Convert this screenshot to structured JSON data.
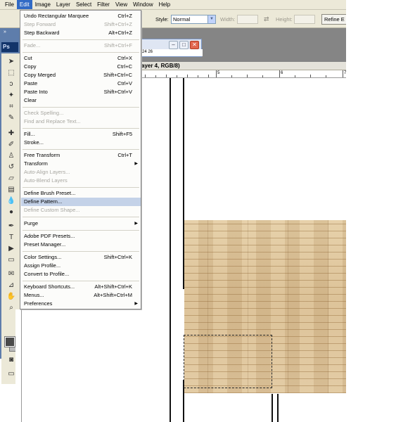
{
  "menubar": {
    "items": [
      "File",
      "Edit",
      "Image",
      "Layer",
      "Select",
      "Filter",
      "View",
      "Window",
      "Help"
    ],
    "active": "Edit"
  },
  "options_bar": {
    "style_label": "Style:",
    "style_value": "Normal",
    "width_label": "Width:",
    "height_label": "Height:",
    "refine_label": "Refine E"
  },
  "toolbox": {
    "logo_text": "Ps",
    "grip": "»"
  },
  "document": {
    "title_text": "ayer 4, RGB/8)",
    "small_ruler_text": "24      26",
    "ruler_numbers": [
      "5",
      "6",
      "7"
    ]
  },
  "edit_menu": {
    "group1": [
      {
        "label": "Undo Rectangular Marquee",
        "shortcut": "Ctrl+Z",
        "enabled": true
      },
      {
        "label": "Step Forward",
        "shortcut": "Shift+Ctrl+Z",
        "enabled": false
      },
      {
        "label": "Step Backward",
        "shortcut": "Alt+Ctrl+Z",
        "enabled": true
      }
    ],
    "group2": [
      {
        "label": "Fade...",
        "shortcut": "Shift+Ctrl+F",
        "enabled": false
      }
    ],
    "group3": [
      {
        "label": "Cut",
        "shortcut": "Ctrl+X",
        "enabled": true
      },
      {
        "label": "Copy",
        "shortcut": "Ctrl+C",
        "enabled": true
      },
      {
        "label": "Copy Merged",
        "shortcut": "Shift+Ctrl+C",
        "enabled": true
      },
      {
        "label": "Paste",
        "shortcut": "Ctrl+V",
        "enabled": true
      },
      {
        "label": "Paste Into",
        "shortcut": "Shift+Ctrl+V",
        "enabled": true
      },
      {
        "label": "Clear",
        "shortcut": "",
        "enabled": true
      }
    ],
    "group4": [
      {
        "label": "Check Spelling...",
        "shortcut": "",
        "enabled": false
      },
      {
        "label": "Find and Replace Text...",
        "shortcut": "",
        "enabled": false
      }
    ],
    "group5": [
      {
        "label": "Fill...",
        "shortcut": "Shift+F5",
        "enabled": true
      },
      {
        "label": "Stroke...",
        "shortcut": "",
        "enabled": true
      }
    ],
    "group6": [
      {
        "label": "Free Transform",
        "shortcut": "Ctrl+T",
        "enabled": true
      },
      {
        "label": "Transform",
        "shortcut": "",
        "enabled": true,
        "submenu": true
      },
      {
        "label": "Auto-Align Layers...",
        "shortcut": "",
        "enabled": false
      },
      {
        "label": "Auto-Blend Layers",
        "shortcut": "",
        "enabled": false
      }
    ],
    "group7": [
      {
        "label": "Define Brush Preset...",
        "shortcut": "",
        "enabled": true
      },
      {
        "label": "Define Pattern...",
        "shortcut": "",
        "enabled": true,
        "highlighted": true
      },
      {
        "label": "Define Custom Shape...",
        "shortcut": "",
        "enabled": false
      }
    ],
    "group8": [
      {
        "label": "Purge",
        "shortcut": "",
        "enabled": true,
        "submenu": true
      }
    ],
    "group9": [
      {
        "label": "Adobe PDF Presets...",
        "shortcut": "",
        "enabled": true
      },
      {
        "label": "Preset Manager...",
        "shortcut": "",
        "enabled": true
      }
    ],
    "group10": [
      {
        "label": "Color Settings...",
        "shortcut": "Shift+Ctrl+K",
        "enabled": true
      },
      {
        "label": "Assign Profile...",
        "shortcut": "",
        "enabled": true
      },
      {
        "label": "Convert to Profile...",
        "shortcut": "",
        "enabled": true
      }
    ],
    "group11": [
      {
        "label": "Keyboard Shortcuts...",
        "shortcut": "Alt+Shift+Ctrl+K",
        "enabled": true
      },
      {
        "label": "Menus...",
        "shortcut": "Alt+Shift+Ctrl+M",
        "enabled": true
      },
      {
        "label": "Preferences",
        "shortcut": "",
        "enabled": true,
        "submenu": true
      }
    ],
    "submenu_arrow": "▶"
  },
  "colors": {
    "menu_highlight": "#316ac5",
    "item_hover": "#c4d2e8",
    "toolbox": "#5e7dab",
    "wood": "#dbc094"
  }
}
